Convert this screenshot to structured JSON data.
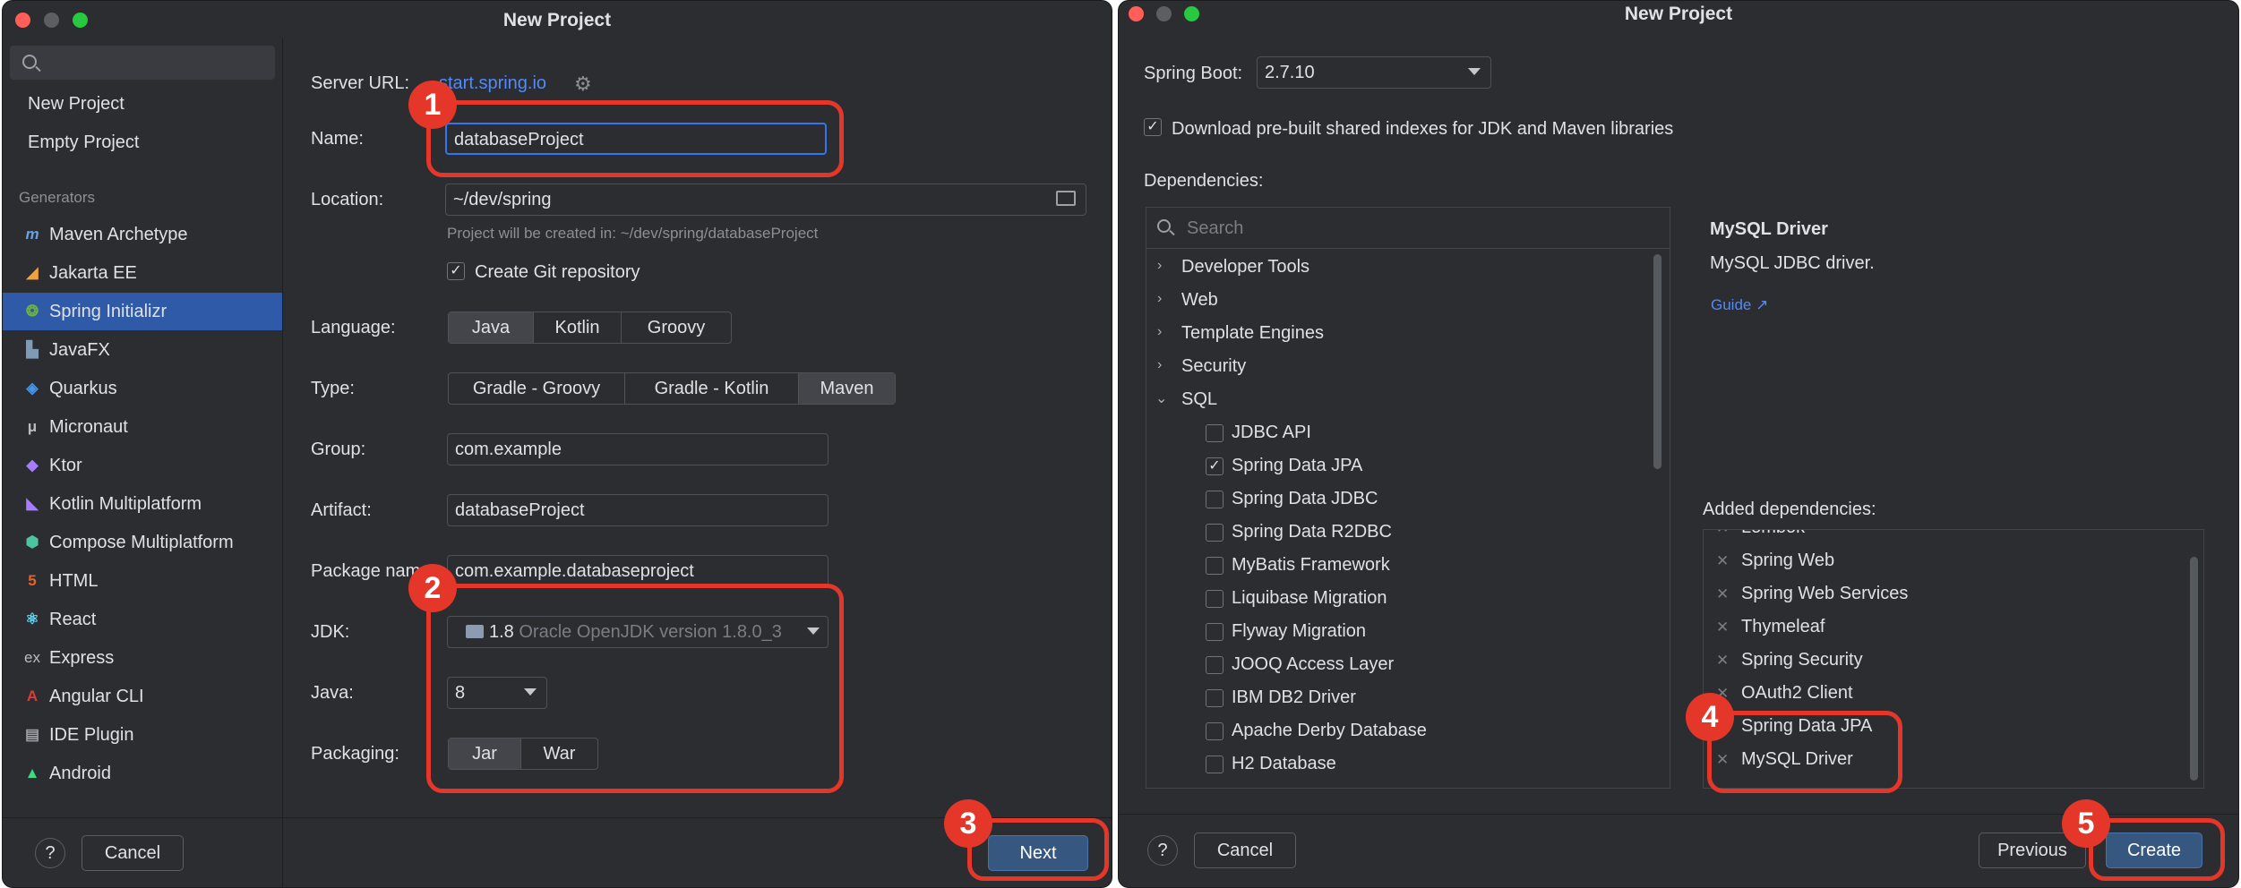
{
  "left_window": {
    "title": "New Project",
    "sidebar": {
      "search_placeholder": "",
      "top_items": [
        "New Project",
        "Empty Project"
      ],
      "generators_heading": "Generators",
      "generators": [
        {
          "label": "Maven Archetype",
          "icon": "maven-icon"
        },
        {
          "label": "Jakarta EE",
          "icon": "jakarta-icon"
        },
        {
          "label": "Spring Initializr",
          "icon": "spring-icon"
        },
        {
          "label": "JavaFX",
          "icon": "javafx-icon"
        },
        {
          "label": "Quarkus",
          "icon": "quarkus-icon"
        },
        {
          "label": "Micronaut",
          "icon": "micronaut-icon"
        },
        {
          "label": "Ktor",
          "icon": "ktor-icon"
        },
        {
          "label": "Kotlin Multiplatform",
          "icon": "kotlin-icon"
        },
        {
          "label": "Compose Multiplatform",
          "icon": "compose-icon"
        },
        {
          "label": "HTML",
          "icon": "html-icon"
        },
        {
          "label": "React",
          "icon": "react-icon"
        },
        {
          "label": "Express",
          "icon": "express-icon"
        },
        {
          "label": "Angular CLI",
          "icon": "angular-icon"
        },
        {
          "label": "IDE Plugin",
          "icon": "plugin-icon"
        },
        {
          "label": "Android",
          "icon": "android-icon"
        }
      ],
      "selected_generator": "Spring Initializr"
    },
    "form": {
      "server_url_label": "Server URL:",
      "server_url_value": "start.spring.io",
      "name_label": "Name:",
      "name_value": "databaseProject",
      "location_label": "Location:",
      "location_value": "~/dev/spring",
      "location_hint": "Project will be created in: ~/dev/spring/databaseProject",
      "git_label": "Create Git repository",
      "git_checked": true,
      "language_label": "Language:",
      "languages": [
        "Java",
        "Kotlin",
        "Groovy"
      ],
      "language_selected": "Java",
      "type_label": "Type:",
      "types": [
        "Gradle - Groovy",
        "Gradle - Kotlin",
        "Maven"
      ],
      "type_selected": "Maven",
      "group_label": "Group:",
      "group_value": "com.example",
      "artifact_label": "Artifact:",
      "artifact_value": "databaseProject",
      "package_label": "Package nam",
      "package_value": "com.example.databaseproject",
      "jdk_label": "JDK:",
      "jdk_version": "1.8",
      "jdk_desc": "Oracle OpenJDK version 1.8.0_3",
      "java_label": "Java:",
      "java_value": "8",
      "packaging_label": "Packaging:",
      "packagings": [
        "Jar",
        "War"
      ],
      "packaging_selected": "Jar"
    },
    "footer": {
      "help": "?",
      "cancel": "Cancel",
      "next": "Next"
    }
  },
  "right_window": {
    "title": "New Project",
    "spring_boot_label": "Spring Boot:",
    "spring_boot_value": "2.7.10",
    "download_label": "Download pre-built shared indexes for JDK and Maven libraries",
    "download_checked": true,
    "dependencies_label": "Dependencies:",
    "search_placeholder": "Search",
    "categories": [
      "Developer Tools",
      "Web",
      "Template Engines",
      "Security",
      "SQL"
    ],
    "sql_items": [
      {
        "label": "JDBC API",
        "checked": false
      },
      {
        "label": "Spring Data JPA",
        "checked": true
      },
      {
        "label": "Spring Data JDBC",
        "checked": false
      },
      {
        "label": "Spring Data R2DBC",
        "checked": false
      },
      {
        "label": "MyBatis Framework",
        "checked": false
      },
      {
        "label": "Liquibase Migration",
        "checked": false
      },
      {
        "label": "Flyway Migration",
        "checked": false
      },
      {
        "label": "JOOQ Access Layer",
        "checked": false
      },
      {
        "label": "IBM DB2 Driver",
        "checked": false
      },
      {
        "label": "Apache Derby Database",
        "checked": false
      },
      {
        "label": "H2 Database",
        "checked": false
      }
    ],
    "detail_title": "MySQL Driver",
    "detail_desc": "MySQL JDBC driver.",
    "detail_link": "Guide ↗",
    "added_label": "Added dependencies:",
    "added": [
      "Lombok",
      "Spring Web",
      "Spring Web Services",
      "Thymeleaf",
      "Spring Security",
      "OAuth2 Client",
      "Spring Data JPA",
      "MySQL Driver"
    ],
    "footer": {
      "help": "?",
      "cancel": "Cancel",
      "previous": "Previous",
      "create": "Create"
    }
  },
  "annotations": [
    "1",
    "2",
    "3",
    "4",
    "5"
  ],
  "colors": {
    "accent": "#2f5aa8",
    "highlight": "#e5362a",
    "link": "#548af7",
    "bg": "#2b2d30"
  }
}
